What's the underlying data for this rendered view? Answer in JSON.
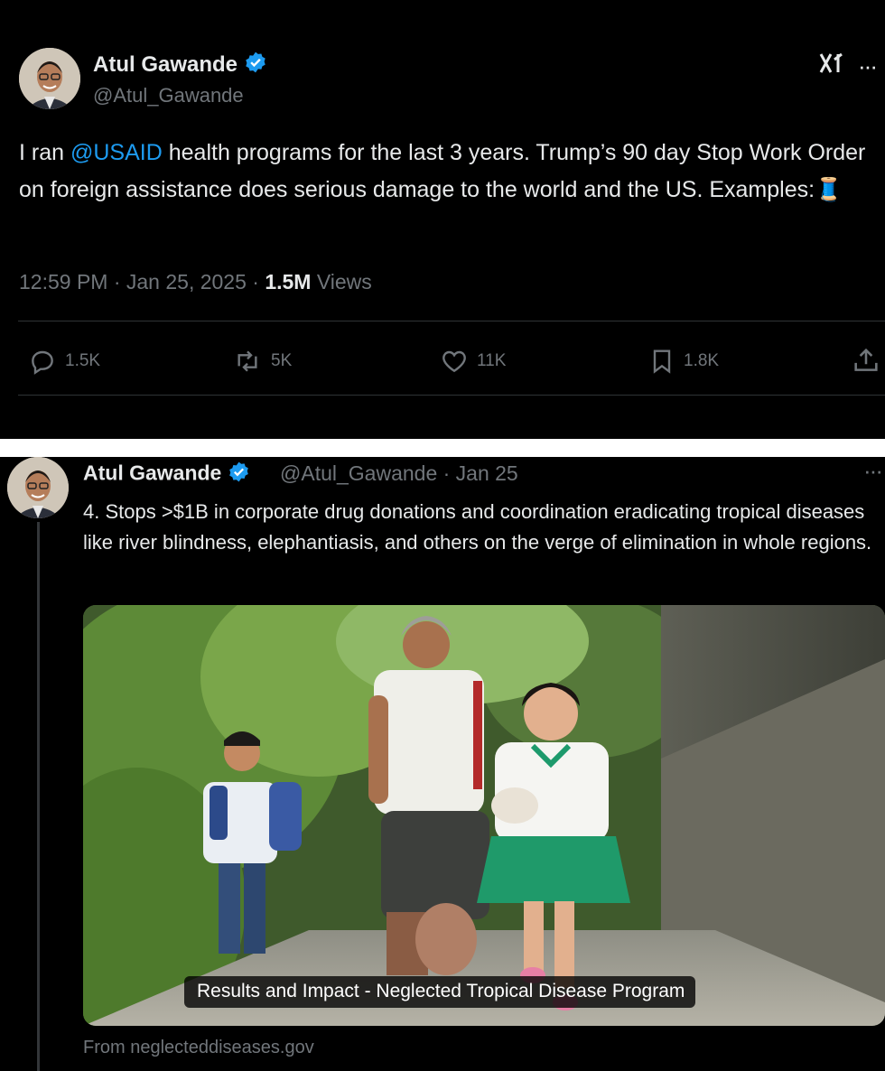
{
  "colors": {
    "background": "#000000",
    "text": "#e7e9ea",
    "secondary": "#71767b",
    "link": "#1d9bf0",
    "verified": "#1d9bf0"
  },
  "tweet1": {
    "author_name": "Atul Gawande",
    "handle": "@Atul_Gawande",
    "text_prefix": "I ran ",
    "mention": "@USAID",
    "text_main": " health programs for the last 3 years. Trump’s 90 day Stop Work Order on foreign assistance does serious damage to the world and the US. Examples:",
    "emoji": "🧵",
    "time": "12:59 PM · Jan 25, 2025 · ",
    "views_count": "1.5M",
    "views_label": " Views",
    "actions": {
      "replies": "1.5K",
      "reposts": "5K",
      "likes": "11K",
      "bookmarks": "1.8K"
    },
    "top_icons": {
      "grok": "x-grok-icon",
      "more": "···"
    }
  },
  "tweet2": {
    "author_name": "Atul Gawande",
    "handle_date": "@Atul_Gawande · Jan 25",
    "more": "···",
    "text": "4. Stops >$1B in corporate drug donations and coordination eradicating tropical diseases like river blindness, elephantiasis, and others on the verge of elimination in whole regions.",
    "media_caption": "Results and Impact - Neglected Tropical Disease Program",
    "source": "From neglecteddiseases.gov"
  }
}
